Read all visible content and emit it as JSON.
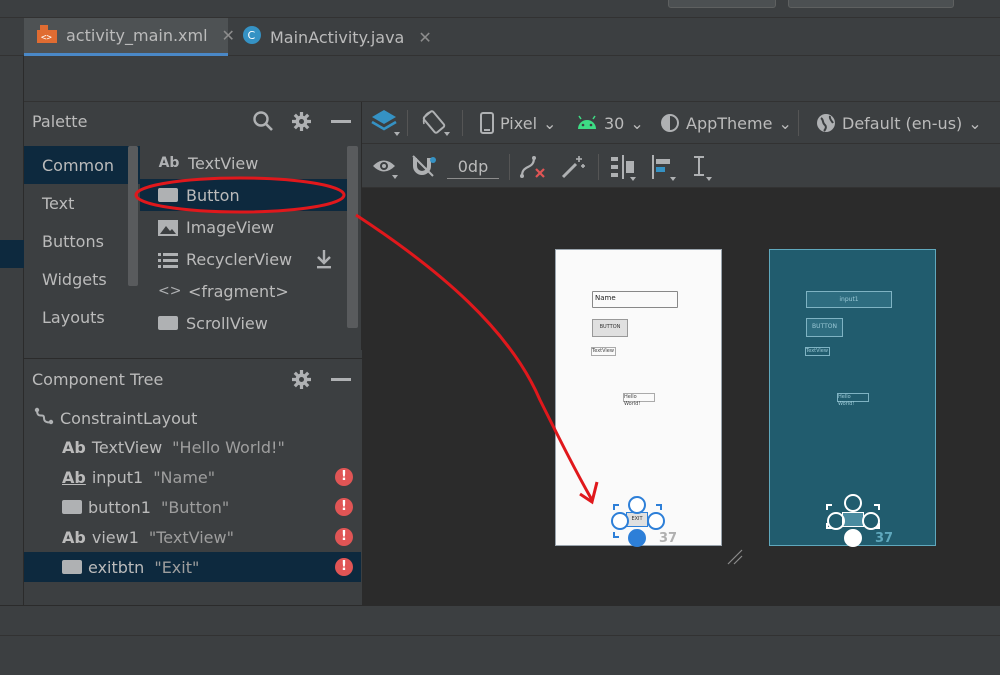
{
  "tabs": [
    {
      "label": "activity_main.xml",
      "icon": "xml-layout-icon"
    },
    {
      "label": "MainActivity.java",
      "icon": "java-class-icon"
    }
  ],
  "palette": {
    "title": "Palette",
    "categories": [
      "Common",
      "Text",
      "Buttons",
      "Widgets",
      "Layouts"
    ],
    "items": [
      {
        "label": "TextView",
        "icon": "ab"
      },
      {
        "label": "Button",
        "icon": "button-rect"
      },
      {
        "label": "ImageView",
        "icon": "image"
      },
      {
        "label": "RecyclerView",
        "icon": "list"
      },
      {
        "label": "<fragment>",
        "icon": "code"
      },
      {
        "label": "ScrollView",
        "icon": "scroll-rect"
      }
    ]
  },
  "component_tree": {
    "title": "Component Tree",
    "items": [
      {
        "label": "ConstraintLayout",
        "value": "",
        "warning": false
      },
      {
        "label": "TextView",
        "value": "\"Hello World!\"",
        "warning": false
      },
      {
        "label": "input1",
        "value": "\"Name\"",
        "warning": true
      },
      {
        "label": "button1",
        "value": "\"Button\"",
        "warning": true
      },
      {
        "label": "view1",
        "value": "\"TextView\"",
        "warning": true
      },
      {
        "label": "exitbtn",
        "value": "\"Exit\"",
        "warning": true
      }
    ]
  },
  "toolbar": {
    "device": "Pixel",
    "api_level": "30",
    "theme": "AppTheme",
    "locale": "Default (en-us)",
    "margin": "0dp"
  },
  "design_preview": {
    "name_field": "Name",
    "button_label": "BUTTON",
    "textview_label": "TextView",
    "hello_label": "Hello World!",
    "exit_label": "EXIT",
    "number": "37"
  },
  "blueprint_preview": {
    "input_label": "input1",
    "button_label": "BUTTON",
    "textview_label": "TextView",
    "hello_label": "Hello World!",
    "number": "37"
  },
  "colors": {
    "selection": "#0d293e",
    "warning": "#e05555",
    "annotation": "#e0181c",
    "blueprint": "#215c6e"
  }
}
